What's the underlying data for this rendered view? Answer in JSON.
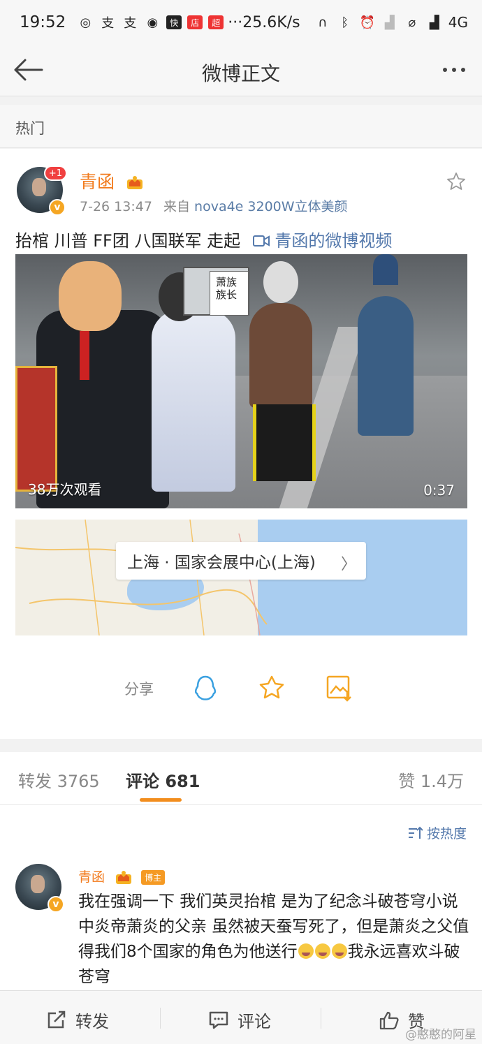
{
  "status_bar": {
    "time": "19:52",
    "net_speed": "···25.6K/s",
    "network": "4G",
    "app_badges": [
      "快",
      "店",
      "超"
    ]
  },
  "nav": {
    "title": "微博正文"
  },
  "section_label": "热门",
  "post": {
    "author": "青函",
    "avatar_plus": "+1",
    "verified_mark": "v",
    "time": "7-26 13:47",
    "from_label": "来自",
    "source": "nova4e 3200W立体美颜",
    "text": "抬棺 川普 FF团 八国联军 走起",
    "video_link": "青函的微博视频",
    "video_views": "38万次观看",
    "video_duration": "0:37",
    "coffin_sign": "萧族族长",
    "location": "上海 · 国家会展中心(上海)"
  },
  "share": {
    "label": "分享",
    "icons": [
      "qq-icon",
      "favorite-star-icon",
      "save-image-icon"
    ]
  },
  "tabs": {
    "repost": "转发 3765",
    "comment": "评论 681",
    "like": "赞 1.4万"
  },
  "comments": {
    "sort_label": "按热度",
    "items": [
      {
        "author": "青函",
        "badge": "博主",
        "text_part1": "我在强调一下 我们英灵抬棺 是为了纪念斗破苍穹小说中炎帝萧炎的父亲 虽然被天蚕写死了，但是萧炎之父值得我们8个国家的角色为他送行",
        "text_part2": "我永远喜欢斗破苍穹"
      }
    ]
  },
  "bottom_bar": {
    "repost": "转发",
    "comment": "评论",
    "like": "赞",
    "watermark": "@憨憨的阿星"
  },
  "colors": {
    "accent": "#f27b1d",
    "link": "#5479ac",
    "tab_underline": "#f28d1d"
  }
}
